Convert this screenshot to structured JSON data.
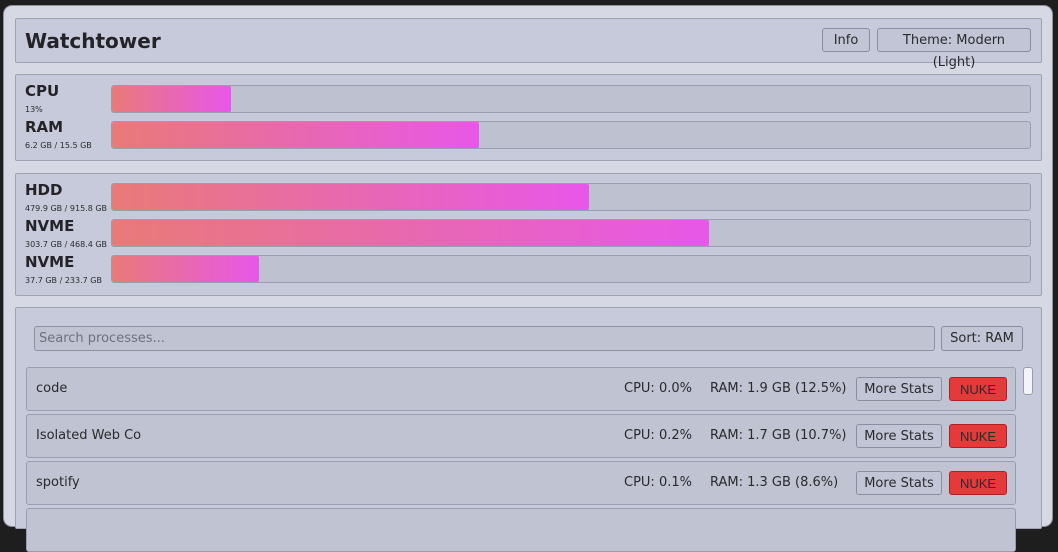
{
  "header": {
    "title": "Watchtower",
    "info_label": "Info",
    "theme_label": "Theme: Modern (Light)"
  },
  "colors": {
    "bar_gradient_start": "#e97a77",
    "bar_gradient_end": "#e857e9",
    "nuke_button": "#e43a3a"
  },
  "system": [
    {
      "name": "CPU",
      "detail": "13%",
      "fraction": 0.13
    },
    {
      "name": "RAM",
      "detail": "6.2 GB / 15.5 GB",
      "fraction": 0.4
    }
  ],
  "disks": [
    {
      "name": "HDD",
      "detail": "479.9 GB / 915.8 GB",
      "fraction": 0.52
    },
    {
      "name": "NVME",
      "detail": "303.7 GB / 468.4 GB",
      "fraction": 0.65
    },
    {
      "name": "NVME",
      "detail": "37.7 GB / 233.7 GB",
      "fraction": 0.16
    }
  ],
  "processes": {
    "search_placeholder": "Search processes...",
    "sort_label": "Sort: RAM",
    "more_label": "More Stats",
    "nuke_label": "NUKE",
    "rows": [
      {
        "name": "code",
        "cpu": "CPU: 0.0%",
        "ram": "RAM: 1.9 GB (12.5%)"
      },
      {
        "name": "Isolated Web Co",
        "cpu": "CPU: 0.2%",
        "ram": "RAM: 1.7 GB (10.7%)"
      },
      {
        "name": "spotify",
        "cpu": "CPU: 0.1%",
        "ram": "RAM: 1.3 GB (8.6%)"
      }
    ]
  }
}
